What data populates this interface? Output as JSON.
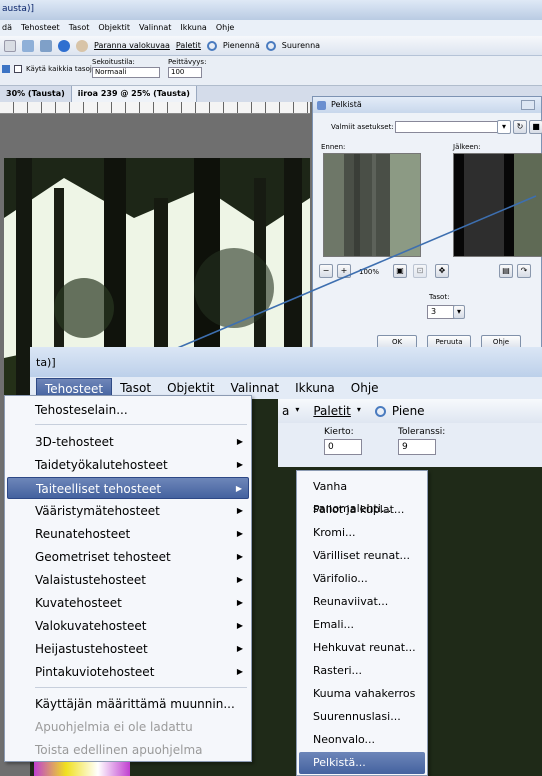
{
  "bg_window": {
    "title": "austa)]",
    "menu": [
      "dä",
      "Tehosteet",
      "Tasot",
      "Objektit",
      "Valinnat",
      "Ikkuna",
      "Ohje"
    ],
    "toolbar": {
      "enhance": "Paranna valokuvaa",
      "palettes": "Paletit",
      "zoom_out": "Pienennä",
      "zoom_in": "Suurenna"
    },
    "options": {
      "use_all_layers": "Käytä kaikkia tasoja",
      "blend_label": "Sekoitustila:",
      "blend_value": "Normaali",
      "opacity_label": "Peittävyys:",
      "opacity_value": "100"
    },
    "tabs": [
      "30% (Tausta)",
      "iiroa 239 @ 25% (Tausta)"
    ]
  },
  "dialog": {
    "title": "Pelkistä",
    "presets_label": "Valmiit asetukset:",
    "before_label": "Ennen:",
    "after_label": "Jälkeen:",
    "zoom": "100%",
    "layers_label": "Tasot:",
    "layers_value": "3",
    "ok": "OK",
    "cancel": "Peruuta",
    "help": "Ohje"
  },
  "fg_window": {
    "title": "ta)]",
    "menu": [
      "Tehosteet",
      "Tasot",
      "Objektit",
      "Valinnat",
      "Ikkuna",
      "Ohje"
    ],
    "toolbar": {
      "a": "a",
      "palettes": "Paletit",
      "zoom": "Piene"
    },
    "options": {
      "rotation_label": "Kierto:",
      "rotation_value": "0",
      "tolerance_label": "Toleranssi:",
      "tolerance_value": "9"
    }
  },
  "effects_menu": {
    "items": [
      {
        "label": "Tehosteselain...",
        "arrow": false,
        "state": "normal"
      },
      {
        "label": "3D-tehosteet",
        "arrow": true,
        "state": "normal"
      },
      {
        "label": "Taidetyökalutehosteet",
        "arrow": true,
        "state": "normal"
      },
      {
        "label": "Taiteelliset tehosteet",
        "arrow": true,
        "state": "highlighted"
      },
      {
        "label": "Vääristymätehosteet",
        "arrow": true,
        "state": "normal"
      },
      {
        "label": "Reunatehosteet",
        "arrow": true,
        "state": "normal"
      },
      {
        "label": "Geometriset tehosteet",
        "arrow": true,
        "state": "normal"
      },
      {
        "label": "Valaistustehosteet",
        "arrow": true,
        "state": "normal"
      },
      {
        "label": "Kuvatehosteet",
        "arrow": true,
        "state": "normal"
      },
      {
        "label": "Valokuvatehosteet",
        "arrow": true,
        "state": "normal"
      },
      {
        "label": "Heijastustehosteet",
        "arrow": true,
        "state": "normal"
      },
      {
        "label": "Pintakuviotehosteet",
        "arrow": true,
        "state": "normal"
      },
      {
        "label": "Käyttäjän määrittämä muunnin...",
        "arrow": false,
        "state": "normal"
      },
      {
        "label": "Apuohjelmia ei ole ladattu",
        "arrow": false,
        "state": "disabled"
      },
      {
        "label": "Toista edellinen apuohjelma",
        "arrow": false,
        "state": "disabled"
      }
    ]
  },
  "artistic_submenu": {
    "items": [
      {
        "label": "Vanha sanomalehti...",
        "state": "normal"
      },
      {
        "label": "Pallot ja kuplat...",
        "state": "normal"
      },
      {
        "label": "Kromi...",
        "state": "normal"
      },
      {
        "label": "Värilliset reunat...",
        "state": "normal"
      },
      {
        "label": "Värifolio...",
        "state": "normal"
      },
      {
        "label": "Reunaviivat...",
        "state": "normal"
      },
      {
        "label": "Emali...",
        "state": "normal"
      },
      {
        "label": "Hehkuvat reunat...",
        "state": "normal"
      },
      {
        "label": "Rasteri...",
        "state": "normal"
      },
      {
        "label": "Kuuma vahakerros",
        "state": "normal"
      },
      {
        "label": "Suurennuslasi...",
        "state": "normal"
      },
      {
        "label": "Neonvalo...",
        "state": "normal"
      },
      {
        "label": "Pelkistä...",
        "state": "highlighted"
      }
    ]
  },
  "colors": {
    "highlight": "#4d69a6",
    "annotation_arrow": "#3d6fb0"
  }
}
